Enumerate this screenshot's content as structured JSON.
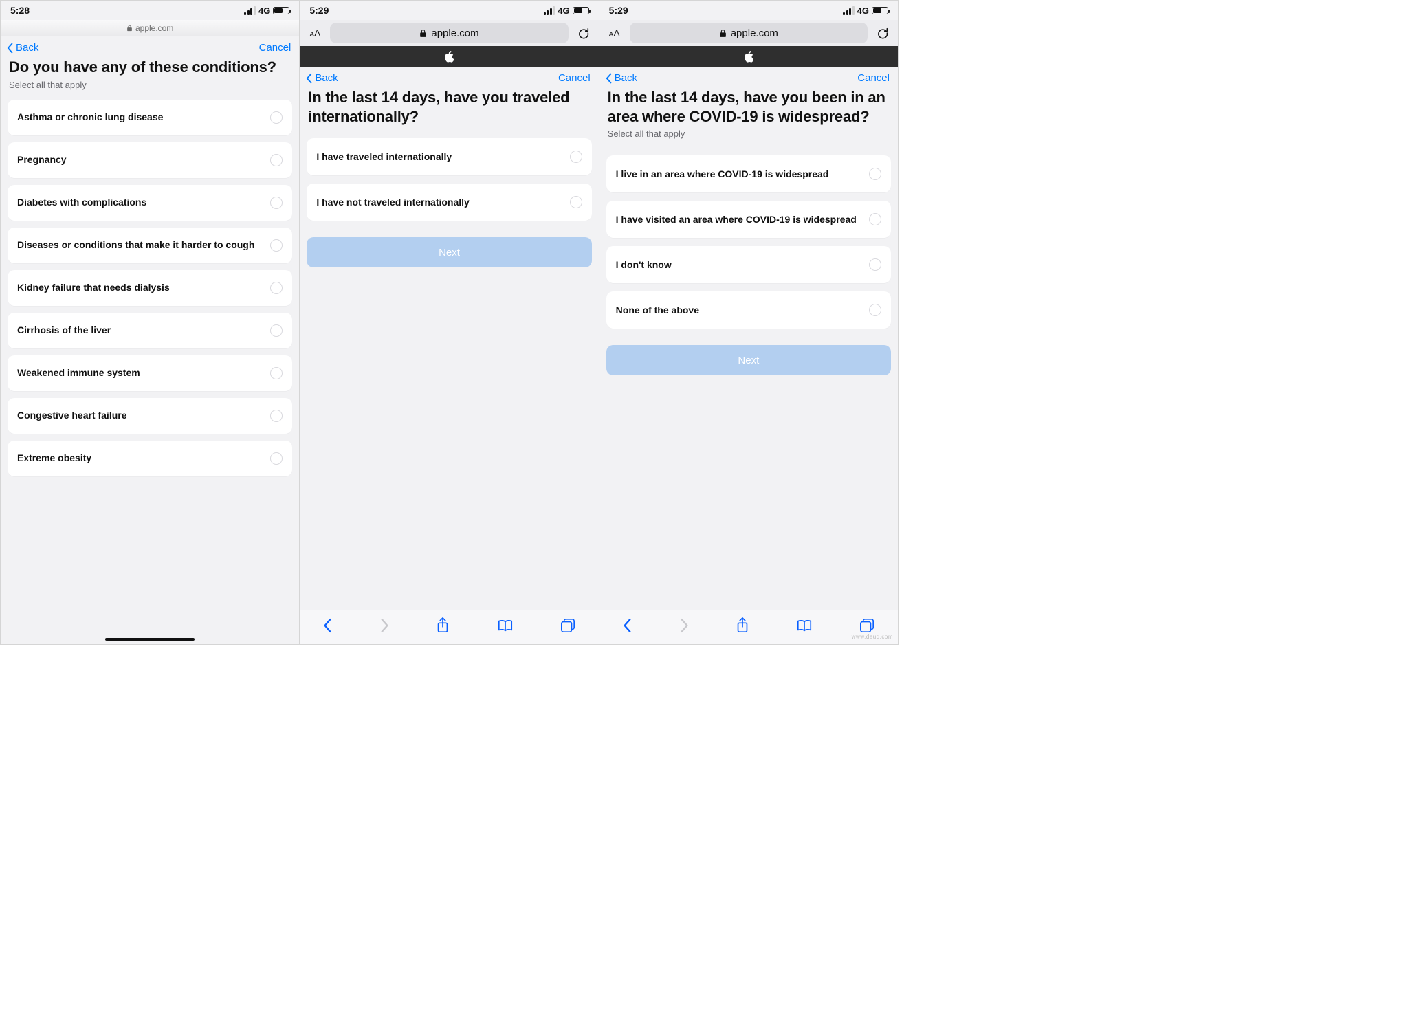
{
  "colors": {
    "link": "#007aff",
    "nextDisabled": "#b3cff0"
  },
  "watermark": "www.deuq.com",
  "screens": [
    {
      "time": "5:28",
      "network": "4G",
      "domain": "apple.com",
      "nav": {
        "back": "Back",
        "cancel": "Cancel"
      },
      "question": "Do you have any of these conditions?",
      "subtext": "Select all that apply",
      "options": [
        "Asthma or chronic lung disease",
        "Pregnancy",
        "Diabetes with complications",
        "Diseases or conditions that make it harder to cough",
        "Kidney failure that needs dialysis",
        "Cirrhosis of the liver",
        "Weakened immune system",
        "Congestive heart failure",
        "Extreme obesity"
      ]
    },
    {
      "time": "5:29",
      "network": "4G",
      "domain": "apple.com",
      "nav": {
        "back": "Back",
        "cancel": "Cancel"
      },
      "question": "In the last 14 days, have you traveled internationally?",
      "options": [
        "I have traveled internationally",
        "I have not traveled internationally"
      ],
      "next": "Next"
    },
    {
      "time": "5:29",
      "network": "4G",
      "domain": "apple.com",
      "nav": {
        "back": "Back",
        "cancel": "Cancel"
      },
      "question": "In the last 14 days, have you been in an area where COVID-19 is widespread?",
      "subtext": "Select all that apply",
      "options": [
        "I live in an area where COVID-19 is widespread",
        "I have visited an area where COVID-19 is widespread",
        "I don't know",
        "None of the above"
      ],
      "next": "Next"
    }
  ]
}
